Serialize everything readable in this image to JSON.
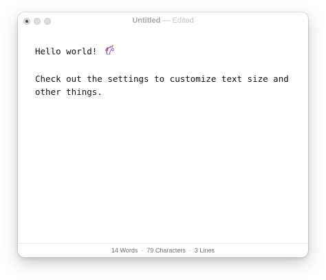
{
  "window": {
    "title": "Untitled",
    "title_separator": "—",
    "status_edited": "Edited"
  },
  "editor": {
    "lines": [
      "Hello world! ",
      "",
      "Check out the settings to customize text size and",
      "other things."
    ],
    "emoji_icon": "unicorn-icon"
  },
  "statusbar": {
    "words": "14 Words",
    "characters": "79 Characters",
    "lines": "3 Lines",
    "separator": "·"
  },
  "colors": {
    "text": "#111111",
    "title_text": "#a6a6a6",
    "status_text": "#707070"
  }
}
